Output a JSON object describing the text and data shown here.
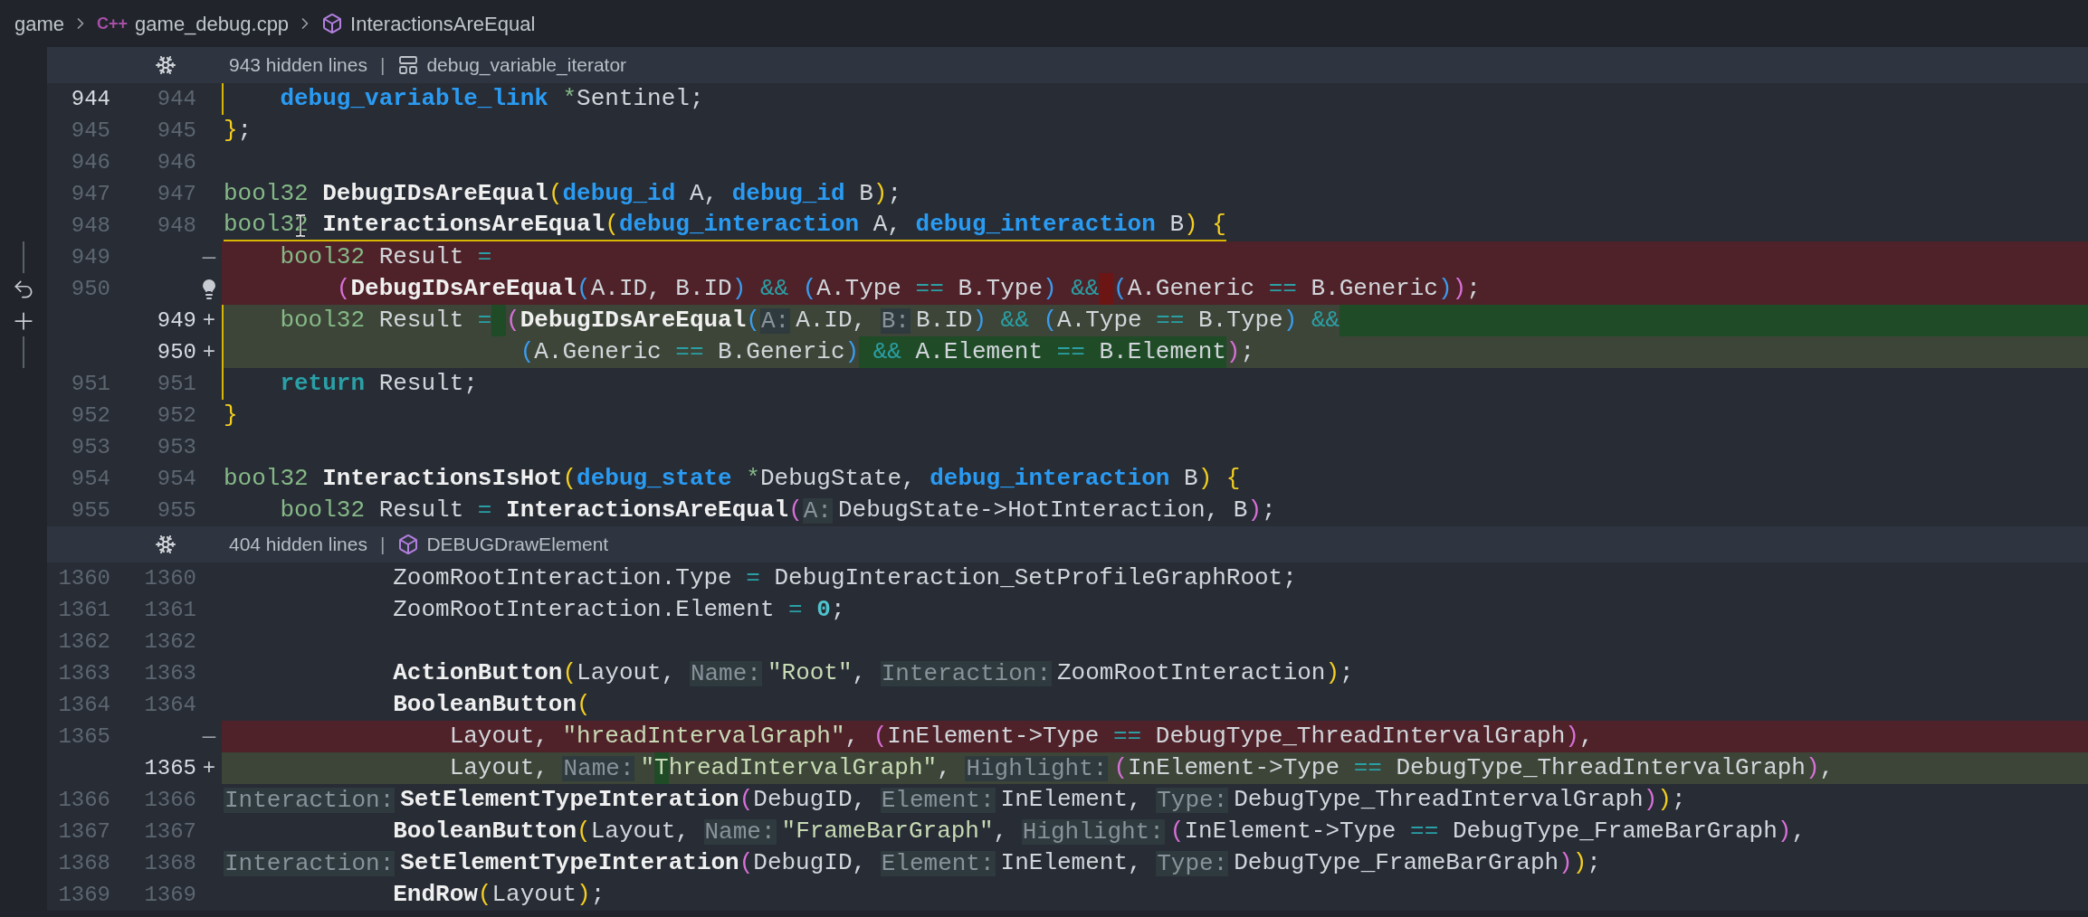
{
  "breadcrumb": {
    "folder": "game",
    "file_badge": "C++",
    "file": "game_debug.cpp",
    "symbol": "InteractionsAreEqual"
  },
  "sections": [
    {
      "hidden_lines": "943 hidden lines",
      "separator": "|",
      "symbol": {
        "kind": "struct",
        "name": "debug_variable_iterator"
      },
      "lines": [
        {
          "old": "944",
          "new": "944",
          "kind": "context",
          "current": true,
          "modified": true,
          "underlined": false,
          "tokens": [
            {
              "text": "    debug_variable_link",
              "kind": "type"
            },
            {
              "text": " *",
              "kind": "ptr"
            },
            {
              "text": "Sentinel;",
              "kind": "plain"
            }
          ]
        },
        {
          "old": "945",
          "new": "945",
          "kind": "context",
          "current": false,
          "modified": false,
          "underlined": false,
          "tokens": [
            {
              "text": "}",
              "kind": "b1"
            },
            {
              "text": ";",
              "kind": "plain"
            }
          ]
        },
        {
          "old": "946",
          "new": "946",
          "kind": "context",
          "current": false,
          "modified": false
        },
        {
          "old": "947",
          "new": "947",
          "kind": "context",
          "current": false,
          "modified": false,
          "underlined": false,
          "tokens": [
            {
              "text": "bool32",
              "kind": "kw"
            },
            {
              "text": " DebugIDsAreEqual",
              "kind": "fn"
            },
            {
              "text": "(",
              "kind": "b1"
            },
            {
              "text": "debug_id",
              "kind": "type"
            },
            {
              "text": " A, ",
              "kind": "plain"
            },
            {
              "text": "debug_id",
              "kind": "type"
            },
            {
              "text": " B",
              "kind": "plain"
            },
            {
              "text": ")",
              "kind": "b1"
            },
            {
              "text": ";",
              "kind": "plain"
            }
          ]
        },
        {
          "old": "948",
          "new": "948",
          "kind": "context",
          "current": false,
          "modified": false,
          "underlined": true,
          "pointer": true,
          "tokens": [
            {
              "text": "bool32",
              "kind": "kw"
            },
            {
              "text": " InteractionsAreEqual",
              "kind": "fn"
            },
            {
              "text": "(",
              "kind": "b1"
            },
            {
              "text": "debug_interaction",
              "kind": "type"
            },
            {
              "text": " A, ",
              "kind": "plain"
            },
            {
              "text": "debug_interaction",
              "kind": "type"
            },
            {
              "text": " B",
              "kind": "plain"
            },
            {
              "text": ")",
              "kind": "b1"
            },
            {
              "text": " {",
              "kind": "b1"
            }
          ]
        },
        {
          "old": "949",
          "marker": "—",
          "kind": "deleted",
          "gutter": {
            "kind": "bar"
          },
          "current": false,
          "modified": false,
          "underlined": false,
          "tokens": [
            {
              "text": "    bool32",
              "kind": "kw"
            },
            {
              "text": " Result ",
              "kind": "plain"
            },
            {
              "text": "=",
              "kind": "op"
            }
          ]
        },
        {
          "old": "950",
          "bulb": true,
          "kind": "deleted",
          "gutter": {
            "kind": "revert"
          },
          "current": false,
          "modified": false,
          "underlined": false,
          "tokens": [
            {
              "text": "        (",
              "kind": "b2"
            },
            {
              "text": "DebugIDsAreEqual",
              "kind": "fn"
            },
            {
              "text": "(",
              "kind": "b3"
            },
            {
              "text": "A.ID, B.ID",
              "kind": "plain"
            },
            {
              "text": ")",
              "kind": "b3"
            },
            {
              "text": " &&",
              "kind": "op"
            },
            {
              "text": " (",
              "kind": "b3"
            },
            {
              "text": "A.Type ",
              "kind": "plain"
            },
            {
              "text": "==",
              "kind": "op"
            },
            {
              "text": " B.Type",
              "kind": "plain"
            },
            {
              "text": ")",
              "kind": "b3"
            },
            {
              "text": " &&",
              "kind": "op"
            },
            {
              "kind": "gap",
              "changed": true
            },
            {
              "text": "(",
              "kind": "b3"
            },
            {
              "text": "A.Generic ",
              "kind": "plain"
            },
            {
              "text": "==",
              "kind": "op"
            },
            {
              "text": " B.Generic",
              "kind": "plain"
            },
            {
              "text": ")",
              "kind": "b3"
            },
            {
              "text": ")",
              "kind": "b2"
            },
            {
              "text": ";",
              "kind": "plain"
            }
          ]
        },
        {
          "new": "949",
          "marker": "+",
          "kind": "added",
          "gutter": {
            "kind": "add"
          },
          "modified": true,
          "underlined": false,
          "changed_to_end": true,
          "tokens": [
            {
              "text": "    bool32",
              "kind": "kw"
            },
            {
              "text": " Result ",
              "kind": "plain"
            },
            {
              "text": "=",
              "kind": "op"
            },
            {
              "kind": "gap",
              "changed": true
            },
            {
              "text": "(",
              "kind": "b2"
            },
            {
              "text": "DebugIDsAreEqual",
              "kind": "fn"
            },
            {
              "text": "(",
              "kind": "b3"
            },
            {
              "text": "A:",
              "kind": "hint"
            },
            {
              "text": "A.ID, ",
              "kind": "plain"
            },
            {
              "text": "B:",
              "kind": "hint"
            },
            {
              "text": "B.ID",
              "kind": "plain"
            },
            {
              "text": ")",
              "kind": "b3"
            },
            {
              "text": " &&",
              "kind": "op"
            },
            {
              "text": " (",
              "kind": "b3"
            },
            {
              "text": "A.Type ",
              "kind": "plain"
            },
            {
              "text": "==",
              "kind": "op"
            },
            {
              "text": " B.Type",
              "kind": "plain"
            },
            {
              "text": ")",
              "kind": "b3"
            },
            {
              "text": " &&",
              "kind": "op"
            }
          ]
        },
        {
          "new": "950",
          "marker": "+",
          "kind": "added",
          "gutter": {
            "kind": "bar"
          },
          "modified": true,
          "underlined": false,
          "tokens": [
            {
              "text": "                     (",
              "kind": "b3"
            },
            {
              "text": "A.Generic ",
              "kind": "plain"
            },
            {
              "text": "==",
              "kind": "op"
            },
            {
              "text": " B.Generic",
              "kind": "plain"
            },
            {
              "text": ")",
              "kind": "b3"
            },
            {
              "text": " &&",
              "kind": "op",
              "changed": true
            },
            {
              "text": " A.Element ",
              "kind": "plain",
              "changed": true
            },
            {
              "text": "==",
              "kind": "op",
              "changed": true
            },
            {
              "text": " B.Element",
              "kind": "plain",
              "changed": true
            },
            {
              "text": ")",
              "kind": "b2"
            },
            {
              "text": ";",
              "kind": "plain"
            }
          ]
        },
        {
          "old": "951",
          "new": "951",
          "kind": "context",
          "current": false,
          "modified": true,
          "underlined": false,
          "tokens": [
            {
              "text": "    return",
              "kind": "ctrl"
            },
            {
              "text": " Result;",
              "kind": "plain"
            }
          ]
        },
        {
          "old": "952",
          "new": "952",
          "kind": "context",
          "current": false,
          "modified": false,
          "underlined": false,
          "tokens": [
            {
              "text": "}",
              "kind": "b1"
            }
          ]
        },
        {
          "old": "953",
          "new": "953",
          "kind": "context",
          "current": false,
          "modified": false
        },
        {
          "old": "954",
          "new": "954",
          "kind": "context",
          "current": false,
          "modified": false,
          "underlined": false,
          "tokens": [
            {
              "text": "bool32",
              "kind": "kw"
            },
            {
              "text": " InteractionsIsHot",
              "kind": "fn"
            },
            {
              "text": "(",
              "kind": "b1"
            },
            {
              "text": "debug_state",
              "kind": "type"
            },
            {
              "text": " *",
              "kind": "ptr"
            },
            {
              "text": "DebugState, ",
              "kind": "plain"
            },
            {
              "text": "debug_interaction",
              "kind": "type"
            },
            {
              "text": " B",
              "kind": "plain"
            },
            {
              "text": ")",
              "kind": "b1"
            },
            {
              "text": " {",
              "kind": "b1"
            }
          ]
        },
        {
          "old": "955",
          "new": "955",
          "kind": "context",
          "current": false,
          "modified": false,
          "underlined": false,
          "tokens": [
            {
              "text": "    bool32",
              "kind": "kw"
            },
            {
              "text": " Result ",
              "kind": "plain"
            },
            {
              "text": "=",
              "kind": "op"
            },
            {
              "text": " InteractionsAreEqual",
              "kind": "fn"
            },
            {
              "text": "(",
              "kind": "b2"
            },
            {
              "text": "A:",
              "kind": "hint"
            },
            {
              "text": "DebugState->HotInteraction, B",
              "kind": "plain"
            },
            {
              "text": ")",
              "kind": "b2"
            },
            {
              "text": ";",
              "kind": "plain"
            }
          ]
        }
      ]
    },
    {
      "hidden_lines": "404 hidden lines",
      "separator": "|",
      "symbol": {
        "kind": "function",
        "name": "DEBUGDrawElement"
      },
      "lines": [
        {
          "old": "1360",
          "new": "1360",
          "kind": "context",
          "current": false,
          "modified": false,
          "underlined": false,
          "tokens": [
            {
              "text": "            ZoomRootInteraction.Type ",
              "kind": "plain"
            },
            {
              "text": "=",
              "kind": "op"
            },
            {
              "text": " DebugInteraction_SetProfileGraphRoot;",
              "kind": "plain"
            }
          ]
        },
        {
          "old": "1361",
          "new": "1361",
          "kind": "context",
          "current": false,
          "modified": false,
          "underlined": false,
          "tokens": [
            {
              "text": "            ZoomRootInteraction.Element ",
              "kind": "plain"
            },
            {
              "text": "=",
              "kind": "op"
            },
            {
              "text": " 0",
              "kind": "num"
            },
            {
              "text": ";",
              "kind": "plain"
            }
          ]
        },
        {
          "old": "1362",
          "new": "1362",
          "kind": "context",
          "current": false,
          "modified": false
        },
        {
          "old": "1363",
          "new": "1363",
          "kind": "context",
          "current": false,
          "modified": false,
          "underlined": false,
          "tokens": [
            {
              "text": "            ActionButton",
              "kind": "fn"
            },
            {
              "text": "(",
              "kind": "b1"
            },
            {
              "text": "Layout, ",
              "kind": "plain"
            },
            {
              "text": "Name:",
              "kind": "hint"
            },
            {
              "text": "\"Root\"",
              "kind": "str"
            },
            {
              "text": ", ",
              "kind": "plain"
            },
            {
              "text": "Interaction:",
              "kind": "hint"
            },
            {
              "text": "ZoomRootInteraction",
              "kind": "plain"
            },
            {
              "text": ")",
              "kind": "b1"
            },
            {
              "text": ";",
              "kind": "plain"
            }
          ]
        },
        {
          "old": "1364",
          "new": "1364",
          "kind": "context",
          "current": false,
          "modified": false,
          "underlined": false,
          "tokens": [
            {
              "text": "            BooleanButton",
              "kind": "fn"
            },
            {
              "text": "(",
              "kind": "b1"
            }
          ]
        },
        {
          "old": "1365",
          "marker": "—",
          "kind": "deleted",
          "current": false,
          "modified": false,
          "underlined": false,
          "tokens": [
            {
              "text": "                Layout, ",
              "kind": "plain"
            },
            {
              "text": "\"hreadIntervalGraph\"",
              "kind": "str"
            },
            {
              "text": ", ",
              "kind": "plain"
            },
            {
              "text": "(",
              "kind": "b2"
            },
            {
              "text": "InElement->Type ",
              "kind": "plain"
            },
            {
              "text": "==",
              "kind": "op"
            },
            {
              "text": " DebugType_ThreadIntervalGraph",
              "kind": "plain"
            },
            {
              "text": ")",
              "kind": "b2"
            },
            {
              "text": ",",
              "kind": "plain"
            }
          ]
        },
        {
          "new": "1365",
          "marker": "+",
          "kind": "added",
          "modified": false,
          "underlined": false,
          "tokens": [
            {
              "text": "                Layout, ",
              "kind": "plain"
            },
            {
              "text": "Name:",
              "kind": "hint"
            },
            {
              "text": "\"",
              "kind": "str"
            },
            {
              "text": "T",
              "kind": "str",
              "changed": true
            },
            {
              "text": "hreadIntervalGraph\"",
              "kind": "str"
            },
            {
              "text": ", ",
              "kind": "plain"
            },
            {
              "text": "Highlight:",
              "kind": "hint"
            },
            {
              "text": "(",
              "kind": "b2"
            },
            {
              "text": "InElement->Type ",
              "kind": "plain"
            },
            {
              "text": "==",
              "kind": "op"
            },
            {
              "text": " DebugType_ThreadIntervalGraph",
              "kind": "plain"
            },
            {
              "text": ")",
              "kind": "b2"
            },
            {
              "text": ",",
              "kind": "plain"
            }
          ]
        },
        {
          "old": "1366",
          "new": "1366",
          "kind": "context",
          "current": false,
          "modified": false,
          "underlined": false,
          "tokens": [
            {
              "text": "                Interaction:",
              "kind": "hint"
            },
            {
              "text": "SetElementTypeInteration",
              "kind": "fn"
            },
            {
              "text": "(",
              "kind": "b2"
            },
            {
              "text": "DebugID, ",
              "kind": "plain"
            },
            {
              "text": "Element:",
              "kind": "hint"
            },
            {
              "text": "InElement, ",
              "kind": "plain"
            },
            {
              "text": "Type:",
              "kind": "hint"
            },
            {
              "text": "DebugType_ThreadIntervalGraph",
              "kind": "plain"
            },
            {
              "text": ")",
              "kind": "b2"
            },
            {
              "text": ")",
              "kind": "b1"
            },
            {
              "text": ";",
              "kind": "plain"
            }
          ]
        },
        {
          "old": "1367",
          "new": "1367",
          "kind": "context",
          "current": false,
          "modified": false,
          "underlined": false,
          "tokens": [
            {
              "text": "            BooleanButton",
              "kind": "fn"
            },
            {
              "text": "(",
              "kind": "b1"
            },
            {
              "text": "Layout, ",
              "kind": "plain"
            },
            {
              "text": "Name:",
              "kind": "hint"
            },
            {
              "text": "\"FrameBarGraph\"",
              "kind": "str"
            },
            {
              "text": ", ",
              "kind": "plain"
            },
            {
              "text": "Highlight:",
              "kind": "hint"
            },
            {
              "text": "(",
              "kind": "b2"
            },
            {
              "text": "InElement->Type ",
              "kind": "plain"
            },
            {
              "text": "==",
              "kind": "op"
            },
            {
              "text": " DebugType_FrameBarGraph",
              "kind": "plain"
            },
            {
              "text": ")",
              "kind": "b2"
            },
            {
              "text": ",",
              "kind": "plain"
            }
          ]
        },
        {
          "old": "1368",
          "new": "1368",
          "kind": "context",
          "current": false,
          "modified": false,
          "underlined": false,
          "tokens": [
            {
              "text": "                          Interaction:",
              "kind": "hint"
            },
            {
              "text": "SetElementTypeInteration",
              "kind": "fn"
            },
            {
              "text": "(",
              "kind": "b2"
            },
            {
              "text": "DebugID, ",
              "kind": "plain"
            },
            {
              "text": "Element:",
              "kind": "hint"
            },
            {
              "text": "InElement, ",
              "kind": "plain"
            },
            {
              "text": "Type:",
              "kind": "hint"
            },
            {
              "text": "DebugType_FrameBarGraph",
              "kind": "plain"
            },
            {
              "text": ")",
              "kind": "b2"
            },
            {
              "text": ")",
              "kind": "b1"
            },
            {
              "text": ";",
              "kind": "plain"
            }
          ]
        },
        {
          "old": "1369",
          "new": "1369",
          "kind": "context",
          "current": false,
          "modified": false,
          "underlined": false,
          "tokens": [
            {
              "text": "            EndRow",
              "kind": "fn"
            },
            {
              "text": "(",
              "kind": "b1"
            },
            {
              "text": "Layout",
              "kind": "plain"
            },
            {
              "text": ")",
              "kind": "b1"
            },
            {
              "text": ";",
              "kind": "plain"
            }
          ]
        }
      ]
    }
  ]
}
